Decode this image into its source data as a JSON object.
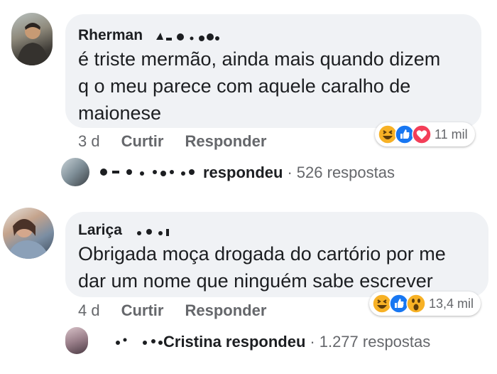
{
  "comments": [
    {
      "name": "Rherman",
      "lines": [
        "é triste mermão, ainda mais quando dizem",
        "q o meu parece com aquele caralho de",
        "maionese"
      ],
      "time": "3 d",
      "like_label": "Curtir",
      "reply_label": "Responder",
      "reaction_icons": [
        "haha-icon",
        "like-icon",
        "love-icon"
      ],
      "reaction_count": "11 mil",
      "replies": {
        "replier_name": "",
        "action": "respondeu",
        "separator": "·",
        "count_text": "526 respostas"
      }
    },
    {
      "name": "Lariça",
      "lines": [
        "Obrigada moça drogada do cartório por me",
        "dar um nome que ninguém sabe escrever"
      ],
      "time": "4 d",
      "like_label": "Curtir",
      "reply_label": "Responder",
      "reaction_icons": [
        "haha-icon",
        "like-icon",
        "wow-icon"
      ],
      "reaction_count": "13,4 mil",
      "replies": {
        "replier_name": "Cristina",
        "action": "respondeu",
        "separator": "·",
        "count_text": "1.277 respostas"
      }
    }
  ],
  "colors": {
    "bubble": "#f0f2f5",
    "meta": "#65676b",
    "like": "#1877f2",
    "love": "#f33e58",
    "haha": "#f7b125"
  }
}
